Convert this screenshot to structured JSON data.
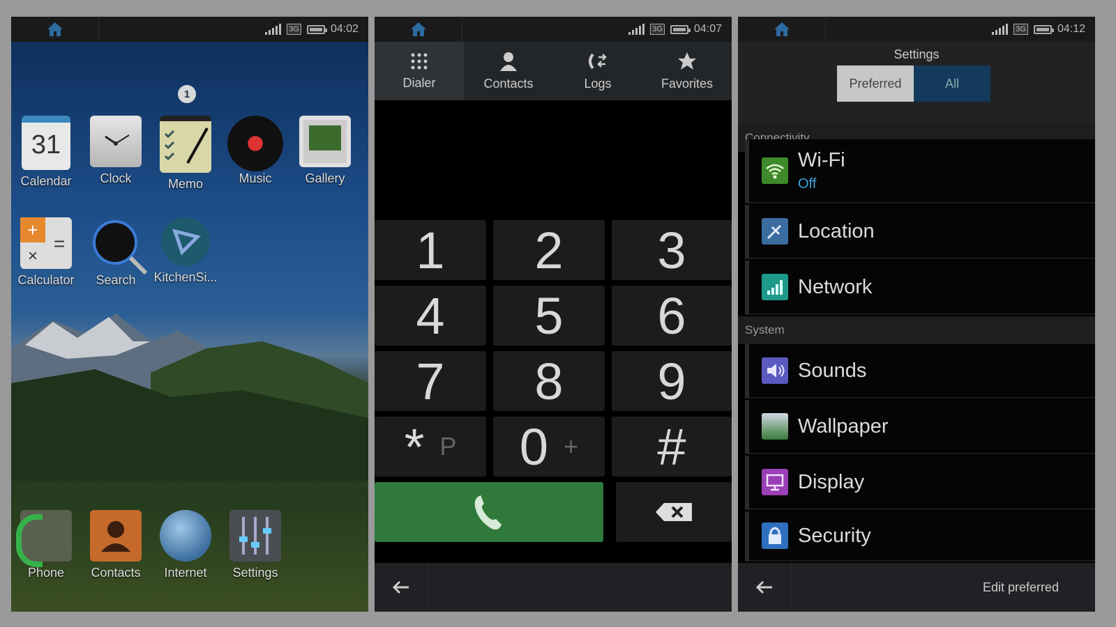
{
  "screens": {
    "home": {
      "time": "04:02",
      "page_indicator": "1",
      "apps_row1": [
        {
          "label": "Calendar",
          "icon": "calendar-icon",
          "day": "31"
        },
        {
          "label": "Clock",
          "icon": "clock-icon"
        },
        {
          "label": "Memo",
          "icon": "memo-icon"
        },
        {
          "label": "Music",
          "icon": "music-icon"
        },
        {
          "label": "Gallery",
          "icon": "gallery-icon"
        }
      ],
      "apps_row2": [
        {
          "label": "Calculator",
          "icon": "calculator-icon"
        },
        {
          "label": "Search",
          "icon": "search-icon"
        },
        {
          "label": "KitchenSi...",
          "icon": "kitchensink-icon"
        }
      ],
      "dock": [
        {
          "label": "Phone",
          "icon": "phone-icon"
        },
        {
          "label": "Contacts",
          "icon": "contacts-icon"
        },
        {
          "label": "Internet",
          "icon": "globe-icon"
        },
        {
          "label": "Settings",
          "icon": "settings-sliders-icon"
        }
      ]
    },
    "dialer": {
      "time": "04:07",
      "tabs": [
        "Dialer",
        "Contacts",
        "Logs",
        "Favorites"
      ],
      "keys": [
        {
          "main": "1"
        },
        {
          "main": "2"
        },
        {
          "main": "3"
        },
        {
          "main": "4"
        },
        {
          "main": "5"
        },
        {
          "main": "6"
        },
        {
          "main": "7"
        },
        {
          "main": "8"
        },
        {
          "main": "9"
        },
        {
          "main": "*",
          "sub": "P"
        },
        {
          "main": "0",
          "sub": "+"
        },
        {
          "main": "#"
        }
      ]
    },
    "settings": {
      "time": "04:12",
      "title": "Settings",
      "segments": [
        "Preferred",
        "All"
      ],
      "sections": [
        {
          "name": "Connectivity",
          "items": [
            {
              "label": "Wi-Fi",
              "sub": "Off",
              "icon": "wifi-icon"
            },
            {
              "label": "Location",
              "icon": "location-icon"
            },
            {
              "label": "Network",
              "icon": "network-icon"
            }
          ]
        },
        {
          "name": "System",
          "items": [
            {
              "label": "Sounds",
              "icon": "sound-icon"
            },
            {
              "label": "Wallpaper",
              "icon": "wallpaper-icon"
            },
            {
              "label": "Display",
              "icon": "display-icon"
            },
            {
              "label": "Security",
              "icon": "lock-icon"
            }
          ]
        }
      ],
      "edit_label": "Edit preferred"
    }
  },
  "status": {
    "network_badge": "3G"
  }
}
